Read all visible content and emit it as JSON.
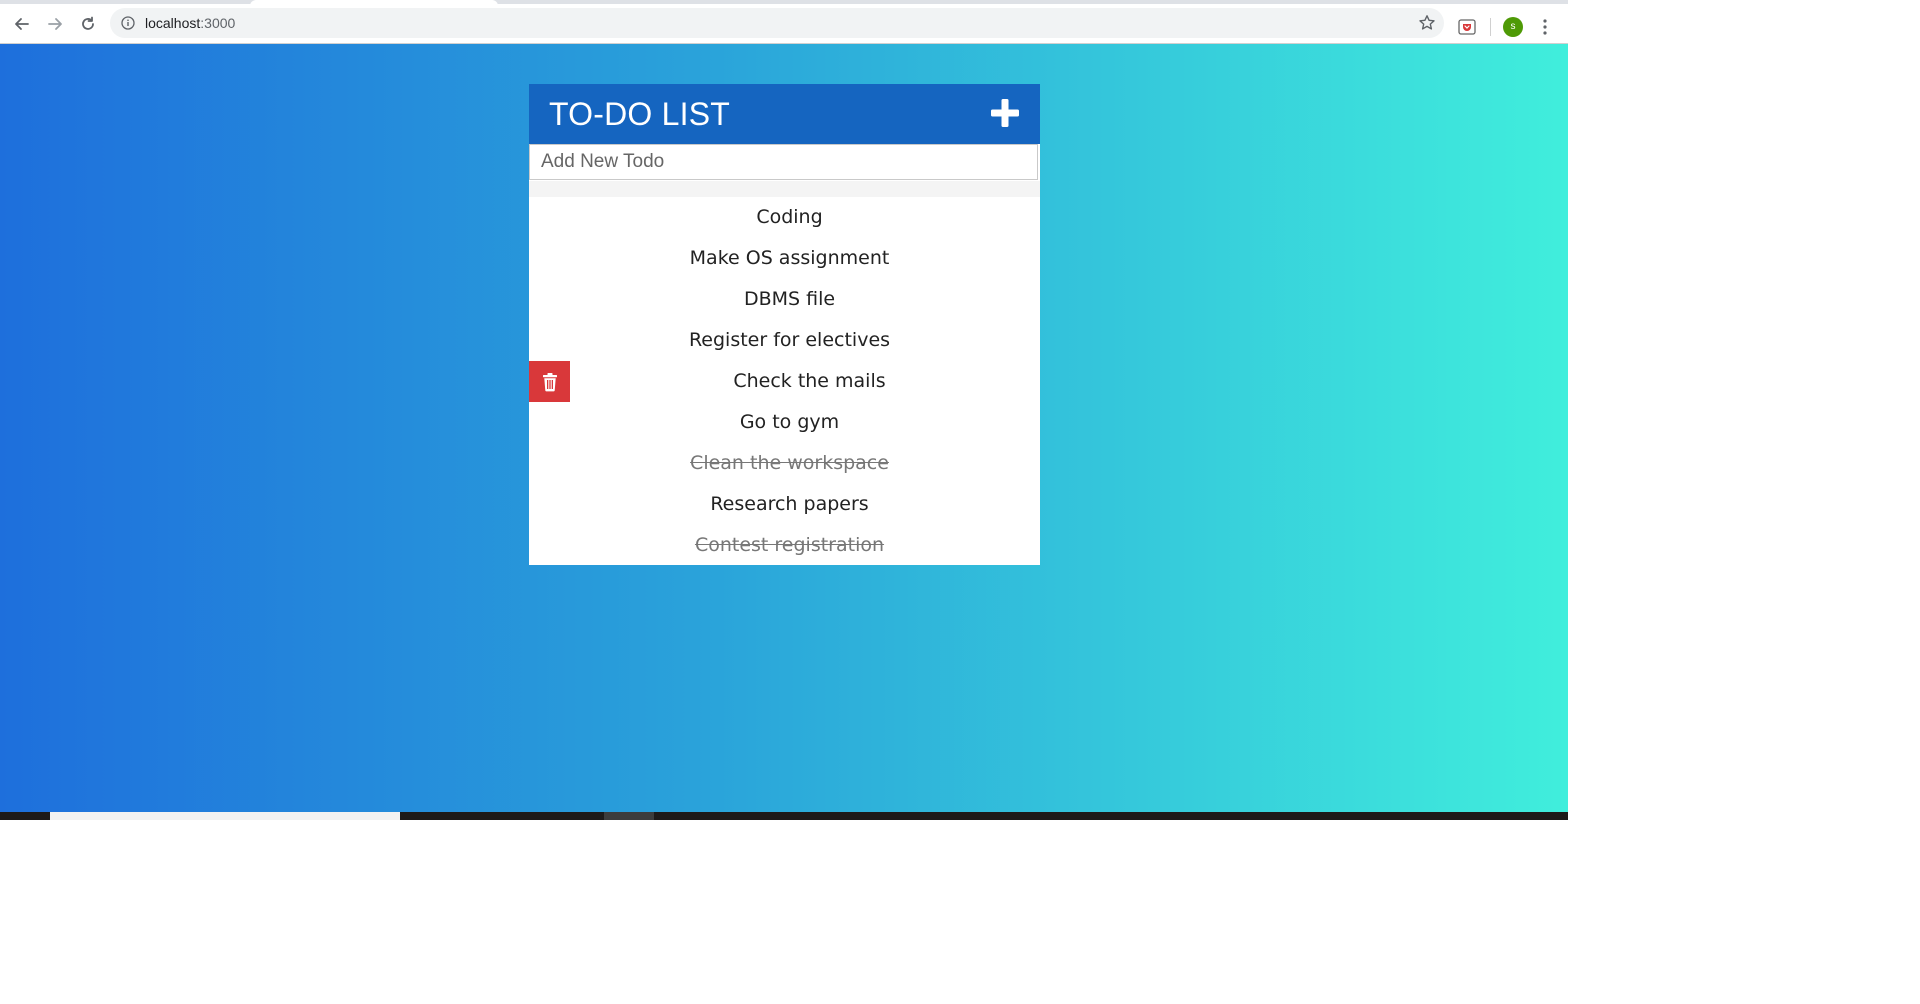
{
  "browser": {
    "url_host": "localhost",
    "url_port": ":3000",
    "profile_initial": "s"
  },
  "app": {
    "title": "TO-DO LIST",
    "input_placeholder": "Add New Todo",
    "todos": [
      {
        "text": "Coding",
        "done": false
      },
      {
        "text": "Make OS assignment",
        "done": false
      },
      {
        "text": "DBMS file",
        "done": false
      },
      {
        "text": "Register for electives",
        "done": false
      },
      {
        "text": "Check the mails",
        "done": false,
        "hovered": true
      },
      {
        "text": "Go to gym",
        "done": false
      },
      {
        "text": "Clean the workspace",
        "done": true
      },
      {
        "text": "Research papers",
        "done": false
      },
      {
        "text": "Contest registration",
        "done": true
      }
    ]
  },
  "icons": {
    "add": "plus-icon",
    "delete": "trash-icon"
  },
  "colors": {
    "header": "#1565c0",
    "delete": "#d9383a",
    "gradient_start": "#1e6fdc",
    "gradient_end": "#40eedc"
  }
}
